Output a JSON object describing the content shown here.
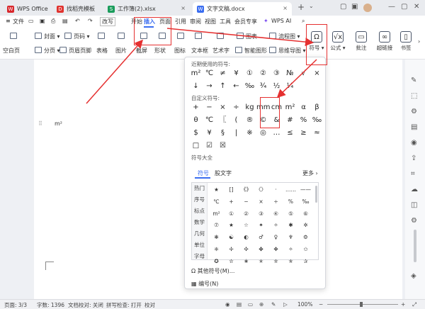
{
  "titlebar": {
    "tabs": [
      {
        "label": "WPS Office",
        "icon": "wps-logo-icon",
        "color": "#d8272c"
      },
      {
        "label": "找稻壳模板",
        "icon": "docer-icon",
        "color": "#e0332f"
      },
      {
        "label": "工作簿(2).xlsx",
        "icon": "spreadsheet-icon",
        "color": "#1a9c5b"
      },
      {
        "label": "文字文稿.docx",
        "icon": "writer-icon",
        "color": "#3a6df0"
      }
    ],
    "new_tab": "+",
    "window_controls": [
      "restore-icon",
      "minimize-icon",
      "maximize-icon",
      "close-icon"
    ]
  },
  "menubar": {
    "file": "文件",
    "mode": "改写",
    "items": [
      "开始",
      "插入",
      "页面",
      "引用",
      "审阅",
      "视图",
      "工具",
      "会员专享"
    ],
    "active": "插入",
    "ai": "WPS AI"
  },
  "ribbon": {
    "row1": [
      "封面",
      "页码",
      "表格",
      "截屏",
      "形状",
      "图表",
      "流程图",
      "思维导图"
    ],
    "row2": [
      "空白页",
      "分页",
      "页眉页脚",
      "图片",
      "截屏",
      "形状",
      "图标",
      "文本框",
      "艺术字",
      "智能图形"
    ],
    "symbol": "符号",
    "formula": "公式",
    "annotate": "批注",
    "hyperlink": "超链接",
    "bookmark": "书签"
  },
  "document": {
    "cursor_text": "m²"
  },
  "dropdown": {
    "recent_title": "近期使用的符号:",
    "recent_symbols": [
      "m²",
      "℃",
      "≠",
      "¥",
      "①",
      "②",
      "③",
      "№",
      "√",
      "×",
      "↓",
      "→",
      "↑",
      "←",
      "‰",
      "¾",
      "½",
      "¼"
    ],
    "custom_title": "自定义符号:",
    "custom_symbols": [
      "+",
      "−",
      "×",
      "÷",
      "kg",
      "mm",
      "cm",
      "m²",
      "α",
      "β",
      "θ",
      "℃",
      "〖",
      "(",
      "®",
      "©",
      "&",
      "#",
      "%",
      "‰",
      "$",
      "¥",
      "§",
      "|",
      "※",
      "◎",
      "…",
      "≤",
      "≥",
      "≈",
      "□",
      "☑",
      "☒"
    ],
    "library_title": "符号大全",
    "library_tabs": [
      "符号",
      "股文字"
    ],
    "more": "更多",
    "categories": [
      "热门",
      "序号",
      "标点",
      "数学",
      "几何",
      "单位",
      "字母"
    ],
    "library_symbols": [
      "★",
      "[]",
      "《》",
      "〈〉",
      "·",
      "……",
      "——",
      "℃",
      "+",
      "−",
      "×",
      "÷",
      "%",
      "‰",
      "m²",
      "①",
      "②",
      "③",
      "④",
      "⑤",
      "⑥",
      "⑦",
      "★",
      "☆",
      "✦",
      "✧",
      "✱",
      "✲",
      "❋",
      "☯",
      "◐",
      "♂",
      "♀",
      "♆",
      "⚙",
      "❈",
      "✢",
      "✣",
      "✤",
      "✥",
      "✧",
      "✩",
      "✪",
      "✫",
      "✬",
      "✭",
      "✮",
      "✯",
      "✰"
    ],
    "other_symbols": "其他符号(M)...",
    "encoding": "编号(N)"
  },
  "status": {
    "page": "页面: 3/3",
    "words": "字数: 1396",
    "proof": "文档校对: 关闭",
    "spell": "拼写检查: 打开",
    "check": "校对",
    "zoom": "100%"
  },
  "colors": {
    "accent": "#3a6df0",
    "annotation": "#e53030"
  }
}
